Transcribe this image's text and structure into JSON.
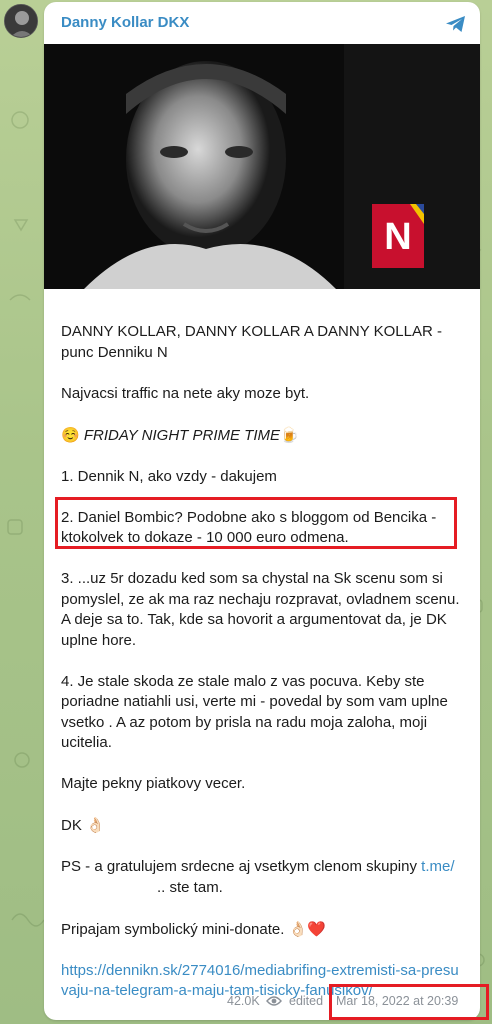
{
  "channel": {
    "name": "Danny Kollar DKX"
  },
  "media": {
    "logo_letter": "N"
  },
  "message": {
    "p1": "DANNY KOLLAR, DANNY KOLLAR A DANNY KOLLAR - punc Denniku N",
    "p2": "Najvacsi traffic na nete aky moze byt.",
    "p3_emoji": "☺️",
    "p3_text": "FRIDAY NIGHT PRIME TIME",
    "p3_emoji_end": "🍺",
    "p4": "1. Dennik N, ako vzdy - dakujem",
    "p5": "2. Daniel Bombic? Podobne ako s bloggom od Bencika - ktokolvek to dokaze - 10 000 euro odmena.",
    "p6": "3. ...uz 5r dozadu ked som sa chystal na Sk scenu som si pomyslel, ze ak ma raz nechaju rozpravat, ovladnem scenu. A deje sa to. Tak, kde sa hovorit a argumentovat da, je DK uplne hore.",
    "p7": "4. Je stale skoda ze stale malo z vas pocuva. Keby ste poriadne natiahli usi, verte mi - povedal by som vam uplne vsetko . A az potom by prisla na radu moja zaloha, moji ucitelia.",
    "p8": "Majte pekny piatkovy vecer.",
    "p9_text": "DK",
    "p9_emoji": "👌🏻",
    "p10_text": "PS - a gratulujem srdecne aj vsetkym clenom skupiny",
    "p10_link": "t.me/",
    "p10_tail": ".. ste tam.",
    "p11_text": "Pripajam symbolický mini-donate.",
    "p11_emoji": "👌🏻❤️",
    "p12_link": "https://dennikn.sk/2774016/mediabrifing-extremisti-sa-presuvaju-na-telegram-a-maju-tam-tisicky-fanusikov/"
  },
  "footer": {
    "views": "42.0K",
    "edited": "edited",
    "timestamp": "Mar 18, 2022 at 20:39"
  },
  "colors": {
    "accent": "#3a8cc4",
    "highlight": "#e51c23",
    "logo_red": "#c8102e"
  },
  "icons": [
    "telegram-icon",
    "eye-icon"
  ]
}
